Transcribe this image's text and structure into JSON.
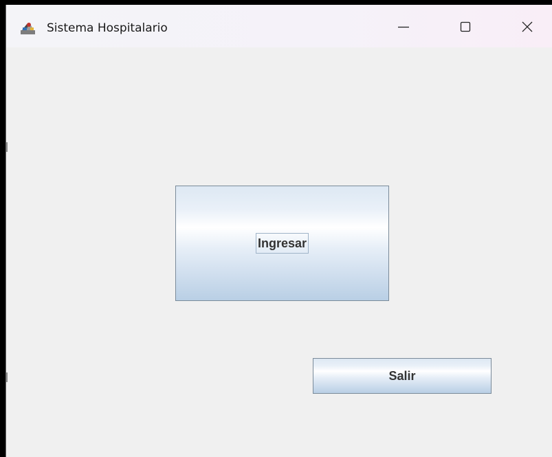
{
  "window": {
    "title": "Sistema Hospitalario",
    "app_icon": "java-app-icon",
    "controls": {
      "minimize_icon": "minimize-icon",
      "maximize_icon": "maximize-icon",
      "close_icon": "close-icon"
    }
  },
  "main": {
    "ingresar_label": "Ingresar",
    "salir_label": "Salir",
    "focused_button": "Ingresar"
  },
  "colors": {
    "background": "#f0f0f0",
    "button_border": "#7a8a99",
    "button_text": "#333333",
    "button_gradient_bottom": "#b9cfe5"
  }
}
